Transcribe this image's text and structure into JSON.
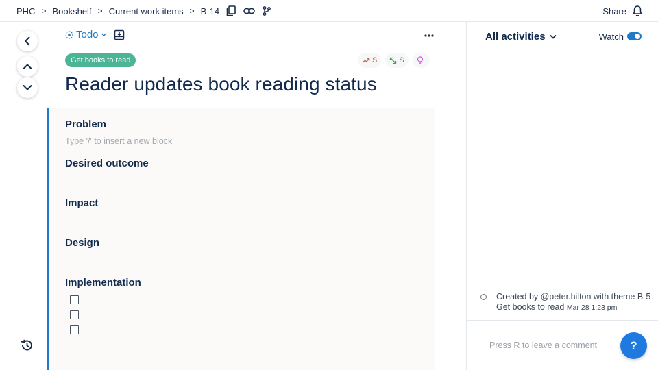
{
  "breadcrumb": {
    "items": [
      "PHC",
      "Bookshelf",
      "Current work items",
      "B-14"
    ],
    "separator": ">"
  },
  "topbar": {
    "share_label": "Share"
  },
  "item": {
    "status": "Todo",
    "theme_tag": "Get books to read",
    "chips": [
      "S",
      "S"
    ],
    "title": "Reader updates book reading status"
  },
  "content": {
    "sections": [
      "Problem",
      "Desired outcome",
      "Impact",
      "Design",
      "Implementation"
    ],
    "placeholder": "Type '/' to insert a new block",
    "checklist_count": 3
  },
  "activity_panel": {
    "filter_label": "All activities",
    "watch_label": "Watch",
    "watch_on": true,
    "entry": {
      "text": "Created by @peter.hilton with theme B-5 Get books to read",
      "time": "Mar 28 1:23 pm"
    },
    "comment_placeholder": "Press R to leave a comment",
    "help_label": "?"
  },
  "colors": {
    "accent": "#1f7ac8",
    "theme_tag": "#4cb596",
    "title": "#112a4d"
  }
}
